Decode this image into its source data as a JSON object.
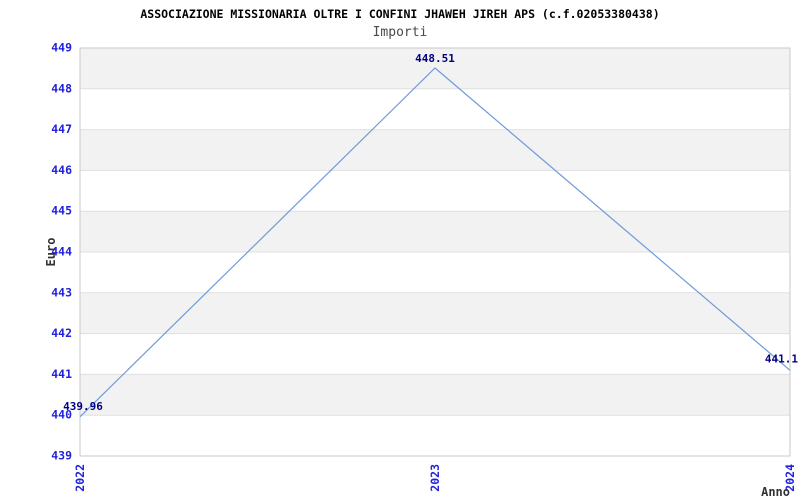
{
  "chart_data": {
    "type": "line",
    "title": "ASSOCIAZIONE MISSIONARIA OLTRE I CONFINI JHAWEH JIREH APS (c.f.02053380438)",
    "subtitle": "Importi",
    "xlabel": "Anno",
    "ylabel": "Euro",
    "categories": [
      "2022",
      "2023",
      "2024"
    ],
    "values": [
      439.96,
      448.51,
      441.1
    ],
    "point_labels": [
      "439.96",
      "448.51",
      "441.1"
    ],
    "ylim": [
      439,
      449
    ],
    "yticks": [
      449,
      448,
      447,
      446,
      445,
      444,
      443,
      442,
      441,
      440,
      439
    ],
    "grid": "horizontal-bands",
    "legend": "none",
    "colors": {
      "line": "#6f9cd9",
      "tick_label": "#2222dd",
      "value_label": "#000080",
      "band": "#f2f2f2",
      "gridline": "#e0e0e0",
      "border": "#c9c9c9",
      "title": "#000000",
      "subtitle": "#4a4a4a",
      "axis_title": "#333333"
    }
  }
}
